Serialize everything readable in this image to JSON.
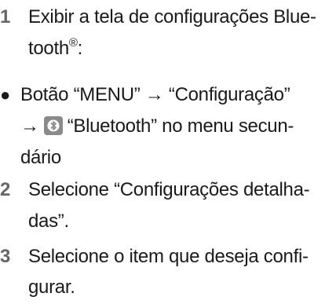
{
  "steps": [
    {
      "number": "1",
      "line1": "Exibir a tela de configurações Blue-",
      "line2_main": "tooth",
      "line2_sup": "®",
      "line2_end": ":"
    },
    {
      "number": "2",
      "line1": "Selecione “Configurações detalha-",
      "line2": "das”."
    },
    {
      "number": "3",
      "line1": "Selecione o item que deseja confi-",
      "line2": "gurar."
    }
  ],
  "bullet": {
    "symbol": "●",
    "line1": "Botão “MENU” → “Configuração”",
    "line2_arrow": "→",
    "line2_icon": "bluetooth-icon",
    "line2_rest": "“Bluetooth” no menu secun-",
    "line3": "dário"
  },
  "colors": {
    "step_number": "#666666",
    "text": "#1a1a1a",
    "icon_bg": "#8a8a8a"
  }
}
